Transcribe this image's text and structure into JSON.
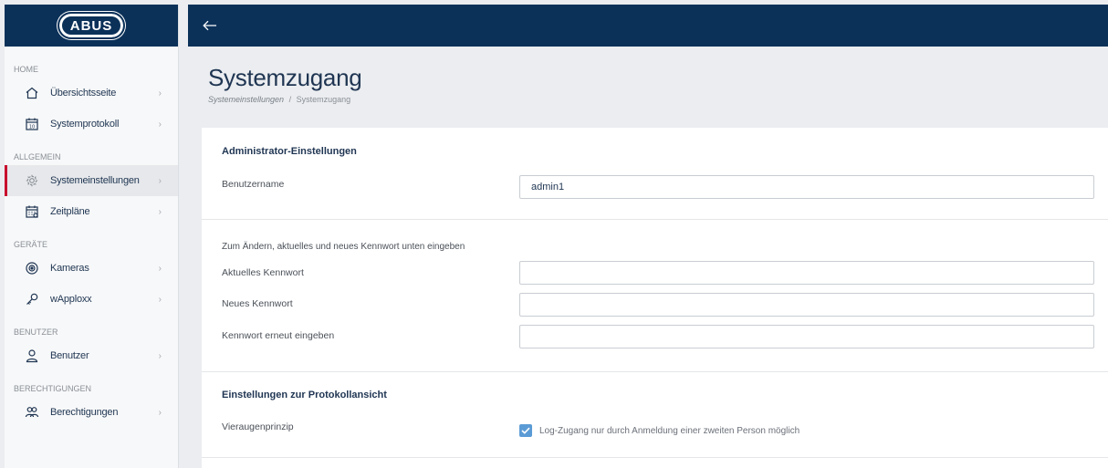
{
  "brand": {
    "logo_text": "ABUS"
  },
  "sidebar": {
    "sections": [
      {
        "label": "HOME"
      },
      {
        "label": "ALLGEMEIN"
      },
      {
        "label": "GERÄTE"
      },
      {
        "label": "BENUTZER"
      },
      {
        "label": "BERECHTIGUNGEN"
      }
    ],
    "items": [
      {
        "label": "Übersichtsseite",
        "icon": "home-icon"
      },
      {
        "label": "Systemprotokoll",
        "icon": "calendar-log-icon"
      },
      {
        "label": "Systemeinstellungen",
        "icon": "gear-icon",
        "active": true
      },
      {
        "label": "Zeitpläne",
        "icon": "calendar-grid-icon"
      },
      {
        "label": "Kameras",
        "icon": "camera-icon"
      },
      {
        "label": "wApploxx",
        "icon": "key-icon"
      },
      {
        "label": "Benutzer",
        "icon": "user-icon"
      },
      {
        "label": "Berechtigungen",
        "icon": "users-icon"
      }
    ]
  },
  "header": {
    "title": "Systemzugang",
    "breadcrumb": {
      "parent": "Systemeinstellungen",
      "separator": "/",
      "current": "Systemzugang"
    }
  },
  "admin": {
    "section_title": "Administrator-Einstellungen",
    "username_label": "Benutzername",
    "username_value": "admin1"
  },
  "password": {
    "hint": "Zum Ändern, aktuelles und neues Kennwort unten eingeben",
    "current_label": "Aktuelles Kennwort",
    "new_label": "Neues Kennwort",
    "repeat_label": "Kennwort erneut eingeben",
    "current_value": "",
    "new_value": "",
    "repeat_value": ""
  },
  "log_view": {
    "section_title": "Einstellungen zur Protokollansicht",
    "four_eyes_label": "Vieraugenprinzip",
    "four_eyes_checkbox_label": "Log-Zugang nur durch Anmeldung einer zweiten Person möglich",
    "four_eyes_checked": true
  },
  "colors": {
    "navy": "#0b3159",
    "accent_red": "#c8102e",
    "checkbox_blue": "#5b9bd5"
  }
}
